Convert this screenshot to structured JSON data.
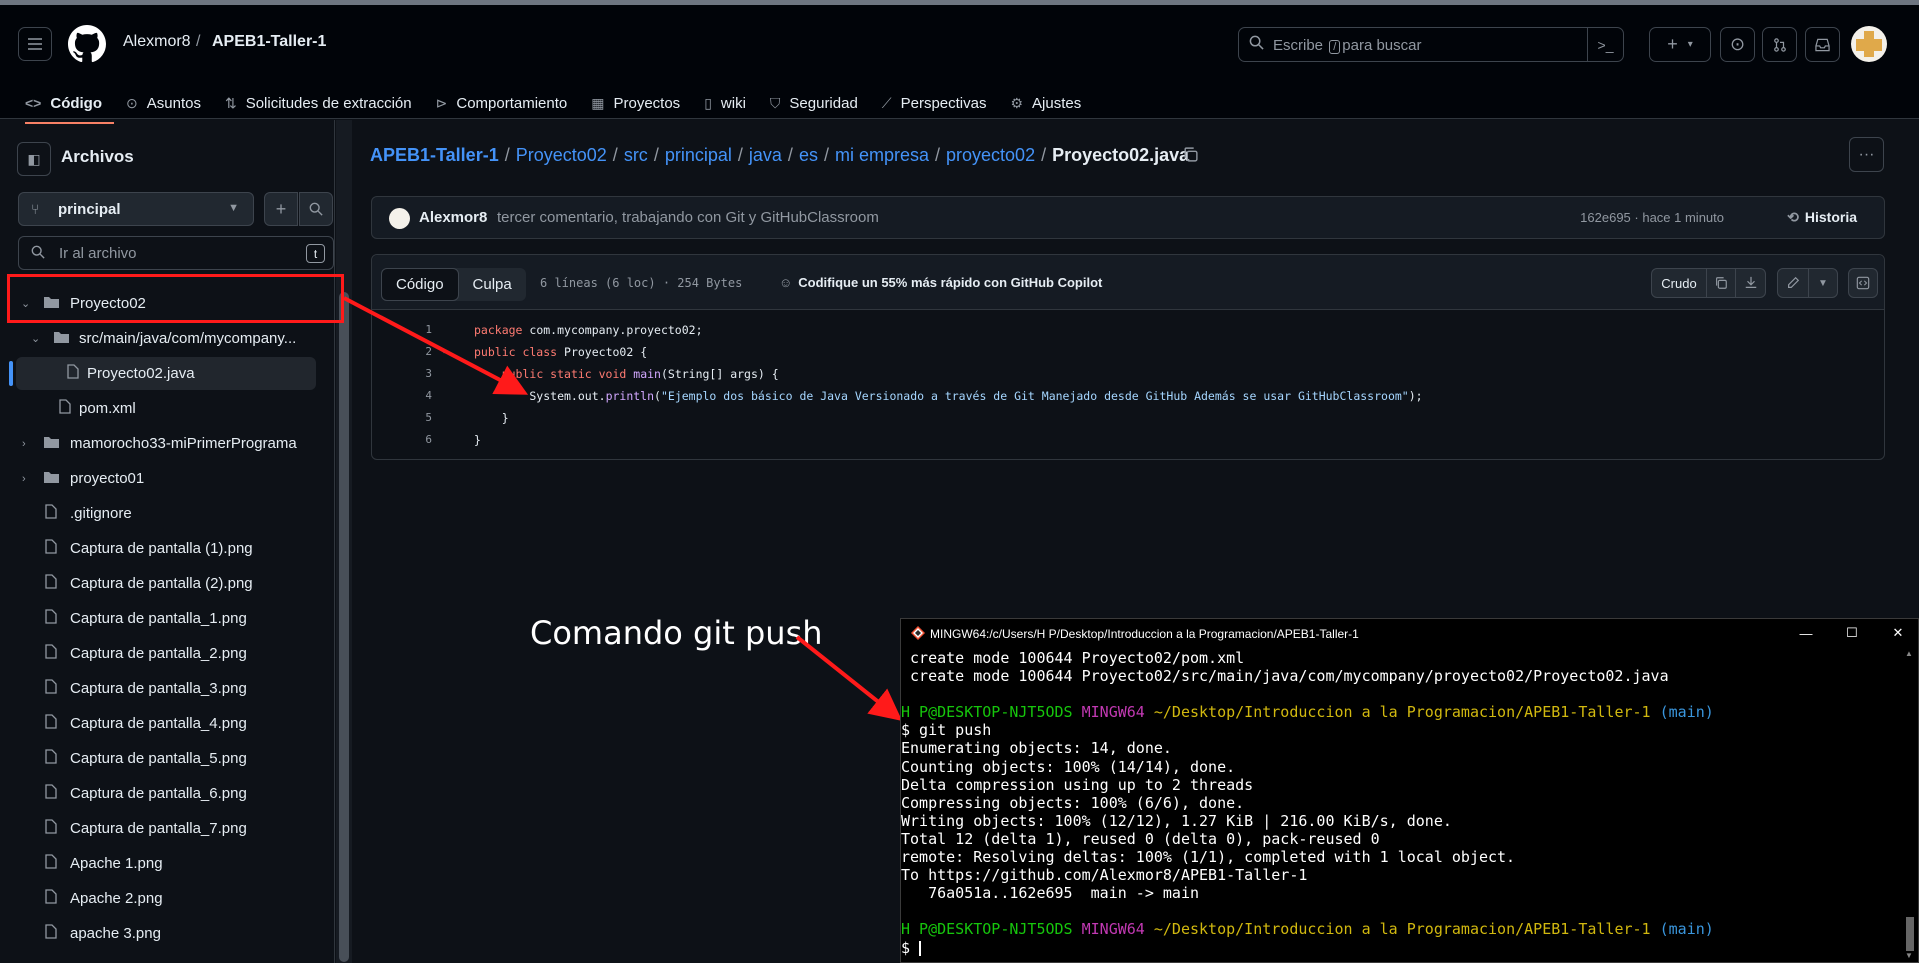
{
  "header": {
    "owner": "Alexmor8",
    "separator": "/",
    "repo": "APEB1-Taller-1",
    "search_prefix": "Escribe",
    "search_key": "/",
    "search_suffix": "para buscar"
  },
  "nav": {
    "code": "Código",
    "issues": "Asuntos",
    "pulls": "Solicitudes de extracción",
    "actions": "Comportamiento",
    "projects": "Proyectos",
    "wiki": "wiki",
    "security": "Seguridad",
    "insights": "Perspectivas",
    "settings": "Ajustes"
  },
  "sidebar": {
    "title": "Archivos",
    "branch": "principal",
    "goto_placeholder": "Ir al archivo",
    "goto_key": "t",
    "tree": [
      {
        "label": "Proyecto02",
        "type": "folder",
        "open": true
      },
      {
        "label": "src/main/java/com/mycompany...",
        "type": "folder",
        "open": true
      },
      {
        "label": "Proyecto02.java",
        "type": "file",
        "selected": true
      },
      {
        "label": "pom.xml",
        "type": "file"
      },
      {
        "label": "mamorocho33-miPrimerPrograma",
        "type": "folder"
      },
      {
        "label": "proyecto01",
        "type": "folder"
      },
      {
        "label": ".gitignore",
        "type": "file"
      },
      {
        "label": "Captura de pantalla (1).png",
        "type": "file"
      },
      {
        "label": "Captura de pantalla (2).png",
        "type": "file"
      },
      {
        "label": "Captura de pantalla_1.png",
        "type": "file"
      },
      {
        "label": "Captura de pantalla_2.png",
        "type": "file"
      },
      {
        "label": "Captura de pantalla_3.png",
        "type": "file"
      },
      {
        "label": "Captura de pantalla_4.png",
        "type": "file"
      },
      {
        "label": "Captura de pantalla_5.png",
        "type": "file"
      },
      {
        "label": "Captura de pantalla_6.png",
        "type": "file"
      },
      {
        "label": "Captura de pantalla_7.png",
        "type": "file"
      },
      {
        "label": "Apache 1.png",
        "type": "file"
      },
      {
        "label": "Apache 2.png",
        "type": "file"
      },
      {
        "label": "apache 3.png",
        "type": "file"
      }
    ]
  },
  "breadcrumb": {
    "items": [
      "APEB1-Taller-1",
      "Proyecto02",
      "src",
      "principal",
      "java",
      "es",
      "mi empresa",
      "proyecto02"
    ],
    "current": "Proyecto02.java",
    "separator": "/"
  },
  "commit": {
    "author": "Alexmor8",
    "message": "tercer comentario, trabajando con Git y GitHubClassroom",
    "hash_time": "162e695 · hace 1 minuto",
    "history": "Historia"
  },
  "file": {
    "tab_code": "Código",
    "tab_blame": "Culpa",
    "meta": "6 líneas (6 loc) · 254 Bytes",
    "copilot": "Codifique un 55% más rápido con GitHub Copilot",
    "raw": "Crudo",
    "lines": [
      {
        "n": "1",
        "parts": [
          [
            "kw",
            "package"
          ],
          [
            "",
            "com.mycompany.proyecto02;"
          ]
        ]
      },
      {
        "n": "2",
        "parts": [
          [
            "kw",
            "public class"
          ],
          [
            "",
            "Proyecto02 {"
          ]
        ]
      },
      {
        "n": "3",
        "parts": [
          [
            "",
            "    "
          ],
          [
            "kw",
            "public static void"
          ],
          [
            "fn",
            "main"
          ],
          [
            "",
            "(String[] args) {"
          ]
        ]
      },
      {
        "n": "4",
        "parts": [
          [
            "",
            "        System.out."
          ],
          [
            "fn",
            "println"
          ],
          [
            "",
            "("
          ],
          [
            "st",
            "\"Ejemplo dos básico de Java Versionado a través de Git Manejado desde GitHub Además se usar GitHubClassroom\""
          ],
          [
            "",
            ");"
          ]
        ]
      },
      {
        "n": "5",
        "parts": [
          [
            "",
            "    }"
          ]
        ]
      },
      {
        "n": "6",
        "parts": [
          [
            "",
            "}"
          ]
        ]
      }
    ]
  },
  "annotation": {
    "text": "Comando git push",
    "color": "#ff1a1a"
  },
  "terminal": {
    "title": "MINGW64:/c/Users/H P/Desktop/Introduccion a la Programacion/APEB1-Taller-1",
    "lines": [
      [
        [
          "",
          " create mode 100644 Proyecto02/pom.xml"
        ]
      ],
      [
        [
          "",
          " create mode 100644 Proyecto02/src/main/java/com/mycompany/proyecto02/Proyecto02.java"
        ]
      ],
      [
        [
          "",
          ""
        ]
      ],
      [
        [
          "g",
          "H P@DESKTOP-NJT5ODS "
        ],
        [
          "m",
          "MINGW64 "
        ],
        [
          "y",
          "~/Desktop/Introduccion a la Programacion/APEB1-Taller-1 "
        ],
        [
          "c",
          "(main)"
        ]
      ],
      [
        [
          "",
          "$ git push"
        ]
      ],
      [
        [
          "",
          "Enumerating objects: 14, done."
        ]
      ],
      [
        [
          "",
          "Counting objects: 100% (14/14), done."
        ]
      ],
      [
        [
          "",
          "Delta compression using up to 2 threads"
        ]
      ],
      [
        [
          "",
          "Compressing objects: 100% (6/6), done."
        ]
      ],
      [
        [
          "",
          "Writing objects: 100% (12/12), 1.27 KiB | 216.00 KiB/s, done."
        ]
      ],
      [
        [
          "",
          "Total 12 (delta 1), reused 0 (delta 0), pack-reused 0"
        ]
      ],
      [
        [
          "",
          "remote: Resolving deltas: 100% (1/1), completed with 1 local object."
        ]
      ],
      [
        [
          "",
          "To https://github.com/Alexmor8/APEB1-Taller-1"
        ]
      ],
      [
        [
          "",
          "   76a051a..162e695  main -> main"
        ]
      ],
      [
        [
          "",
          ""
        ]
      ],
      [
        [
          "g",
          "H P@DESKTOP-NJT5ODS "
        ],
        [
          "m",
          "MINGW64 "
        ],
        [
          "y",
          "~/Desktop/Introduccion a la Programacion/APEB1-Taller-1 "
        ],
        [
          "c",
          "(main)"
        ]
      ],
      [
        [
          "",
          "$ "
        ]
      ]
    ]
  }
}
